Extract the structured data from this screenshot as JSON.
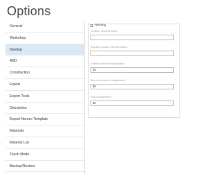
{
  "window": {
    "title": "Options"
  },
  "sidebar": {
    "items": [
      {
        "label": "General"
      },
      {
        "label": "Workshop"
      },
      {
        "label": "Nesting"
      },
      {
        "label": "ABD"
      },
      {
        "label": "Construction"
      },
      {
        "label": "Export"
      },
      {
        "label": "Export Tools"
      },
      {
        "label": "Directories"
      },
      {
        "label": "Export Names Template"
      },
      {
        "label": "Materials"
      },
      {
        "label": "Material List"
      },
      {
        "label": "Touch Mode"
      },
      {
        "label": "Backup/Restore"
      }
    ],
    "active_index": 2
  },
  "nesting": {
    "group_label": "Nesting",
    "checked": false,
    "fields": [
      {
        "label": "Contour element name:",
        "value": ""
      },
      {
        "label": "Security contour element name:",
        "value": ""
      },
      {
        "label": "Default contour enlargement:",
        "value": "25"
      },
      {
        "label": "Security contour enlargement:",
        "value": "35"
      },
      {
        "label": "Saw enlargement:",
        "value": "45"
      }
    ]
  },
  "colors": {
    "active_bg": "#dbe8f5",
    "border": "#dcdcdc"
  }
}
